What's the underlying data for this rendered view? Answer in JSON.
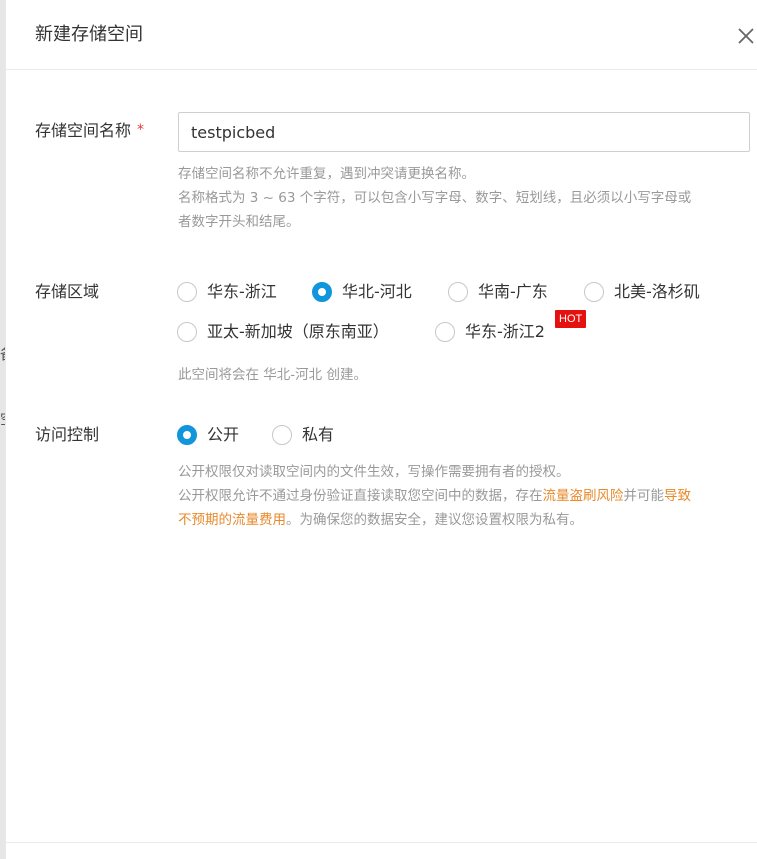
{
  "dialog": {
    "title": "新建存储空间"
  },
  "backdrop": {
    "glyph1": "备",
    "glyph2": "空"
  },
  "bucket_name": {
    "label": "存储空间名称",
    "required_mark": "*",
    "value": "testpicbed",
    "hint_line1": "存储空间名称不允许重复，遇到冲突请更换名称。",
    "hint_line2": "名称格式为 3 ~ 63 个字符，可以包含小写字母、数字、短划线，且必须以小写字母或",
    "hint_line3": "者数字开头和结尾。"
  },
  "region": {
    "label": "存储区域",
    "options": [
      {
        "label": "华东-浙江",
        "checked": false
      },
      {
        "label": "华北-河北",
        "checked": true
      },
      {
        "label": "华南-广东",
        "checked": false
      },
      {
        "label": "北美-洛杉矶",
        "checked": false
      },
      {
        "label": "亚太-新加坡（原东南亚）",
        "checked": false
      },
      {
        "label": "华东-浙江2",
        "checked": false
      }
    ],
    "hot_badge": "HOT",
    "hint": "此空间将会在 华北-河北 创建。"
  },
  "access": {
    "label": "访问控制",
    "options": [
      {
        "label": "公开",
        "checked": true
      },
      {
        "label": "私有",
        "checked": false
      }
    ],
    "hint_line1": "公开权限仅对读取空间内的文件生效，写操作需要拥有者的授权。",
    "hint_line2_a": "公开权限允许不通过身份验证直接读取您空间中的数据，存在",
    "hint_link1": "流量盗刷风险",
    "hint_line2_b": "并可能",
    "hint_link2a": "导致",
    "hint_link2b": "不预期的流量费用",
    "hint_line3_b": "。为确保您的数据安全，建议您设置权限为私有。"
  },
  "colors": {
    "accent": "#1296db",
    "link": "#e8892b",
    "hot": "#e4110f",
    "required": "#e4393c"
  }
}
